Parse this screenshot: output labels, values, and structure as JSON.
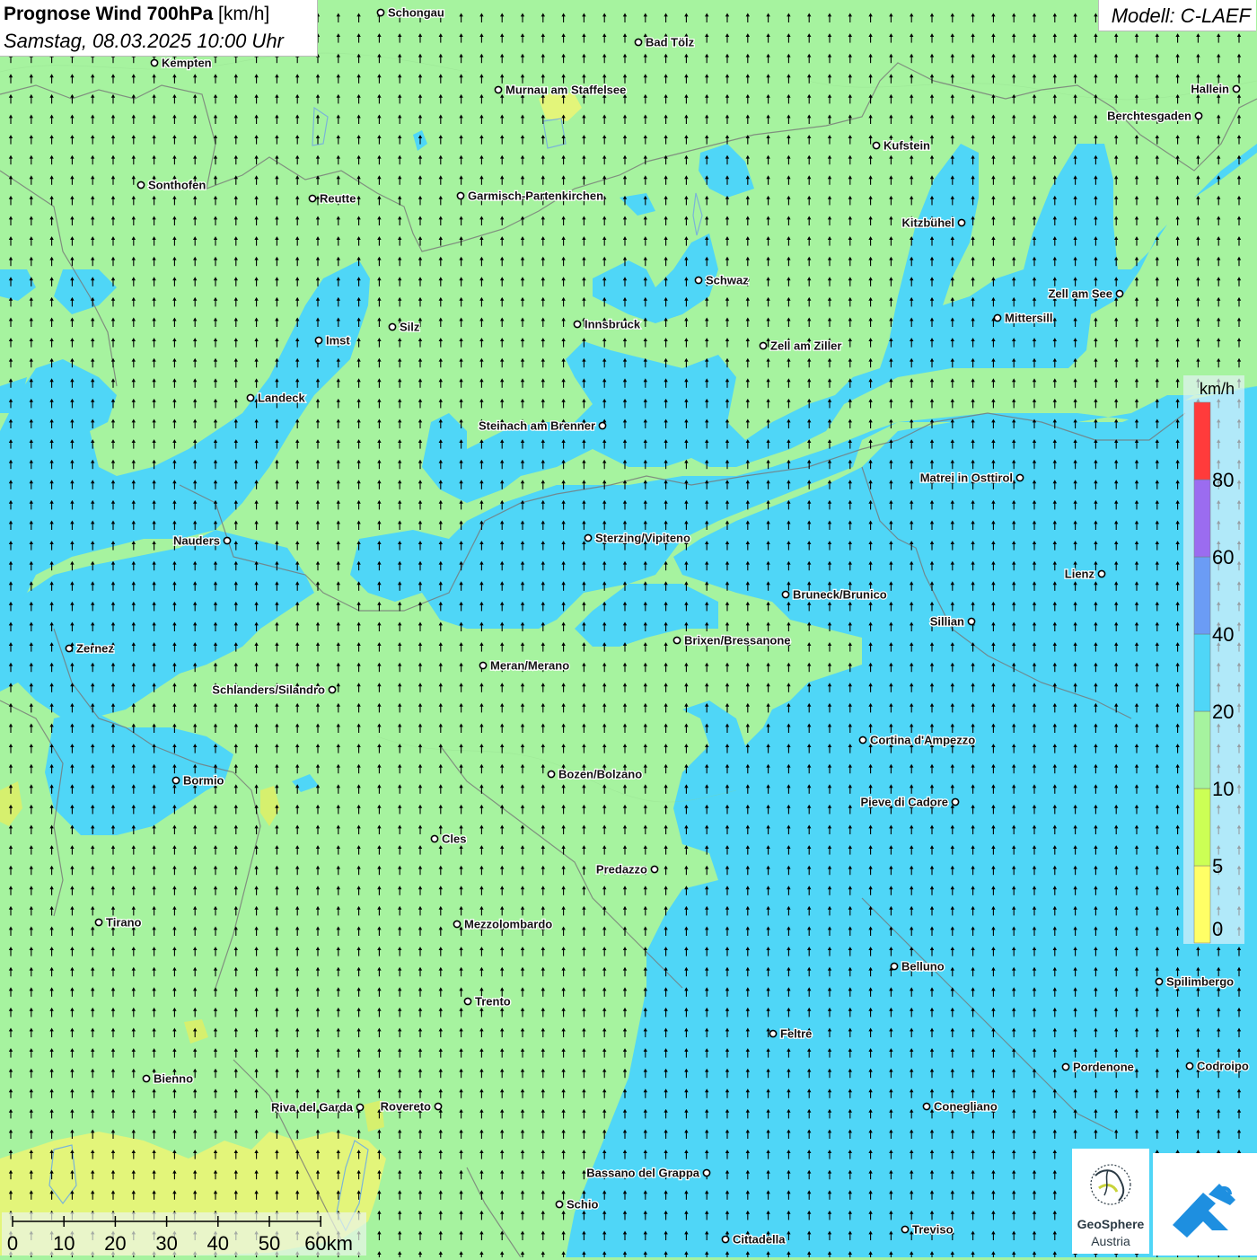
{
  "header": {
    "title_bold": "Prognose Wind 700hPa",
    "title_unit": "[km/h]",
    "datetime": "Samstag, 08.03.2025 10:00 Uhr"
  },
  "model": {
    "label": "Modell: C-LAEF"
  },
  "legend": {
    "unit": "km/h",
    "bins": [
      {
        "from": 0,
        "to": 5,
        "color": "#ffff66"
      },
      {
        "from": 5,
        "to": 10,
        "color": "#ccff55"
      },
      {
        "from": 10,
        "to": 20,
        "color": "#a6f39f"
      },
      {
        "from": 20,
        "to": 40,
        "color": "#4fd6f7"
      },
      {
        "from": 40,
        "to": 60,
        "color": "#6b9cf5"
      },
      {
        "from": 60,
        "to": 80,
        "color": "#9b6cf0"
      },
      {
        "from": 80,
        "to": "",
        "color": "#ff3b3b"
      }
    ],
    "tick_labels": [
      "0",
      "5",
      "10",
      "20",
      "40",
      "60",
      "80"
    ]
  },
  "scale_bar": {
    "labels": [
      "0",
      "10",
      "20",
      "30",
      "40",
      "50",
      "60km"
    ]
  },
  "wind": {
    "direction": "north",
    "arrow_color": "#000000"
  },
  "cities": [
    {
      "name": "Schongau"
    },
    {
      "name": "Bad Tölz"
    },
    {
      "name": "Kempten"
    },
    {
      "name": "Hallein"
    },
    {
      "name": "Murnau am Staffelsee"
    },
    {
      "name": "Berchtesgaden"
    },
    {
      "name": "Kufstein"
    },
    {
      "name": "Sonthofen"
    },
    {
      "name": "Reutte"
    },
    {
      "name": "Garmisch-Partenkirchen"
    },
    {
      "name": "Kitzbühel"
    },
    {
      "name": "Schwaz"
    },
    {
      "name": "Zell am See"
    },
    {
      "name": "Mittersill"
    },
    {
      "name": "Innsbruck"
    },
    {
      "name": "Silz"
    },
    {
      "name": "Imst"
    },
    {
      "name": "Zell am Ziller"
    },
    {
      "name": "Landeck"
    },
    {
      "name": "Steinach am Brenner"
    },
    {
      "name": "Matrei in Osttirol"
    },
    {
      "name": "Nauders"
    },
    {
      "name": "Sterzing/Vipiteno"
    },
    {
      "name": "Lienz"
    },
    {
      "name": "Bruneck/Brunico"
    },
    {
      "name": "Sillian"
    },
    {
      "name": "Brixen/Bressanone"
    },
    {
      "name": "Zernez"
    },
    {
      "name": "Meran/Merano"
    },
    {
      "name": "Schlanders/Silandro"
    },
    {
      "name": "Cortina d'Ampezzo"
    },
    {
      "name": "Bozen/Bolzano"
    },
    {
      "name": "Bormio"
    },
    {
      "name": "Pieve di Cadore"
    },
    {
      "name": "Cles"
    },
    {
      "name": "Predazzo"
    },
    {
      "name": "Tirano"
    },
    {
      "name": "Mezzolombardo"
    },
    {
      "name": "Belluno"
    },
    {
      "name": "Spilimbergo"
    },
    {
      "name": "Trento"
    },
    {
      "name": "Feltre"
    },
    {
      "name": "Pordenone"
    },
    {
      "name": "Codroipo"
    },
    {
      "name": "Bienno"
    },
    {
      "name": "Riva del Garda"
    },
    {
      "name": "Rovereto"
    },
    {
      "name": "Conegliano"
    },
    {
      "name": "Bassano del Grappa"
    },
    {
      "name": "Schio"
    },
    {
      "name": "Treviso"
    },
    {
      "name": "Cittadella"
    }
  ],
  "logos": {
    "geosphere_line1": "GeoSphere",
    "geosphere_line2": "Austria"
  }
}
